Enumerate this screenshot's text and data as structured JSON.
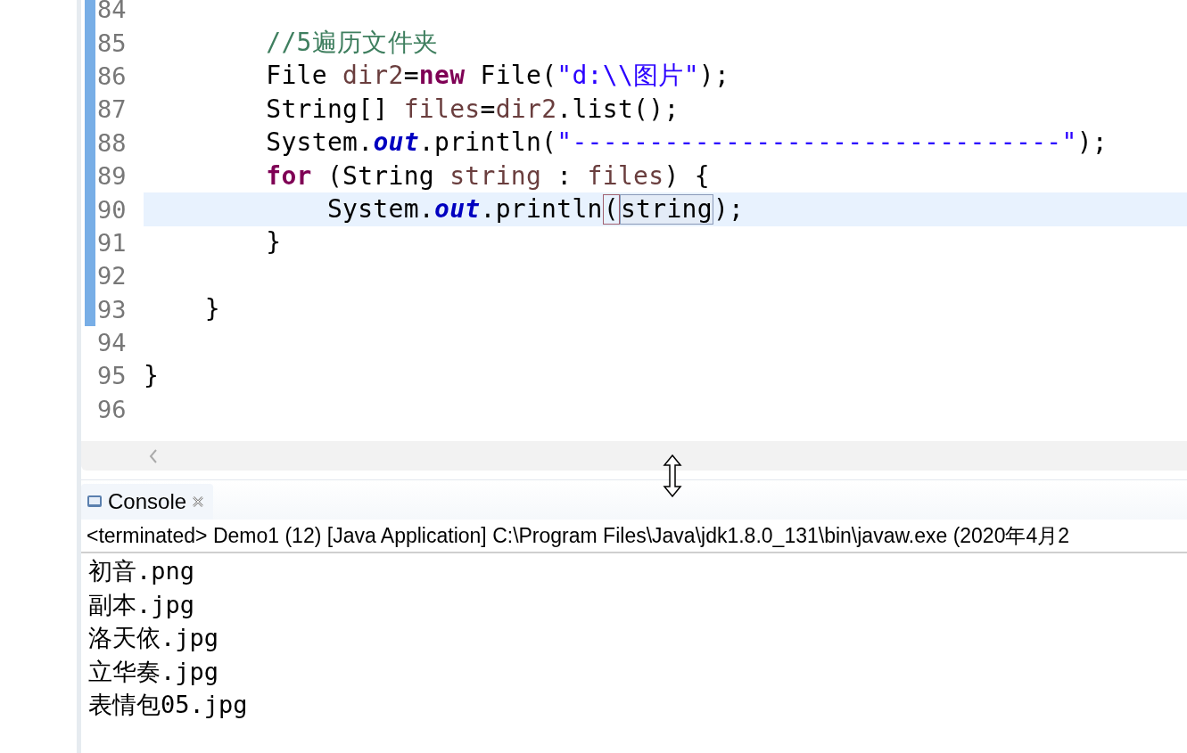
{
  "editor": {
    "lines": [
      {
        "number": "84",
        "current": false,
        "in_range": true
      },
      {
        "number": "85",
        "current": false,
        "in_range": true,
        "tokens": [
          {
            "kind": "comment",
            "text": "        //5遍历文件夹"
          }
        ]
      },
      {
        "number": "86",
        "current": false,
        "in_range": true,
        "tokens": [
          {
            "kind": "plain",
            "text": "        File "
          },
          {
            "kind": "local",
            "text": "dir2"
          },
          {
            "kind": "plain",
            "text": "="
          },
          {
            "kind": "keyword",
            "text": "new"
          },
          {
            "kind": "plain",
            "text": " File("
          },
          {
            "kind": "string",
            "text": "\"d:\\\\图片\""
          },
          {
            "kind": "plain",
            "text": ");"
          }
        ]
      },
      {
        "number": "87",
        "current": false,
        "in_range": true,
        "tokens": [
          {
            "kind": "plain",
            "text": "        String[] "
          },
          {
            "kind": "local",
            "text": "files"
          },
          {
            "kind": "plain",
            "text": "="
          },
          {
            "kind": "local",
            "text": "dir2"
          },
          {
            "kind": "plain",
            "text": ".list();"
          }
        ]
      },
      {
        "number": "88",
        "current": false,
        "in_range": true,
        "tokens": [
          {
            "kind": "plain",
            "text": "        System."
          },
          {
            "kind": "field",
            "text": "out"
          },
          {
            "kind": "plain",
            "text": ".println("
          },
          {
            "kind": "string",
            "text": "\"--------------------------------\""
          },
          {
            "kind": "plain",
            "text": ");"
          }
        ]
      },
      {
        "number": "89",
        "current": false,
        "in_range": true,
        "tokens": [
          {
            "kind": "keyword",
            "text": "        for"
          },
          {
            "kind": "plain",
            "text": " (String "
          },
          {
            "kind": "local",
            "text": "string"
          },
          {
            "kind": "plain",
            "text": " : "
          },
          {
            "kind": "local",
            "text": "files"
          },
          {
            "kind": "plain",
            "text": ") {"
          }
        ]
      },
      {
        "number": "90",
        "current": true,
        "in_range": true,
        "tokens": [
          {
            "kind": "plain",
            "text": "            System."
          },
          {
            "kind": "field",
            "text": "out"
          },
          {
            "kind": "plain",
            "text": ".println"
          },
          {
            "kind": "bracket-match",
            "text": "("
          },
          {
            "kind": "occurrence",
            "text": "string"
          },
          {
            "kind": "plain",
            "text": ");"
          }
        ]
      },
      {
        "number": "91",
        "current": false,
        "in_range": true,
        "tokens": [
          {
            "kind": "plain",
            "text": "        }"
          }
        ]
      },
      {
        "number": "92",
        "current": false,
        "in_range": true
      },
      {
        "number": "93",
        "current": false,
        "in_range": true,
        "tokens": [
          {
            "kind": "plain",
            "text": "    }"
          }
        ]
      },
      {
        "number": "94",
        "current": false,
        "in_range": false
      },
      {
        "number": "95",
        "current": false,
        "in_range": false,
        "tokens": [
          {
            "kind": "plain",
            "text": "}"
          }
        ]
      },
      {
        "number": "96",
        "current": false,
        "in_range": false
      }
    ]
  },
  "console": {
    "tab": {
      "label": "Console",
      "selected": true
    },
    "header": "<terminated> Demo1 (12) [Java Application] C:\\Program Files\\Java\\jdk1.8.0_131\\bin\\javaw.exe (2020年4月2",
    "output": [
      "初音.png",
      "副本.jpg",
      "洛天依.jpg",
      "立华奏.jpg",
      "表情包05.jpg"
    ]
  }
}
